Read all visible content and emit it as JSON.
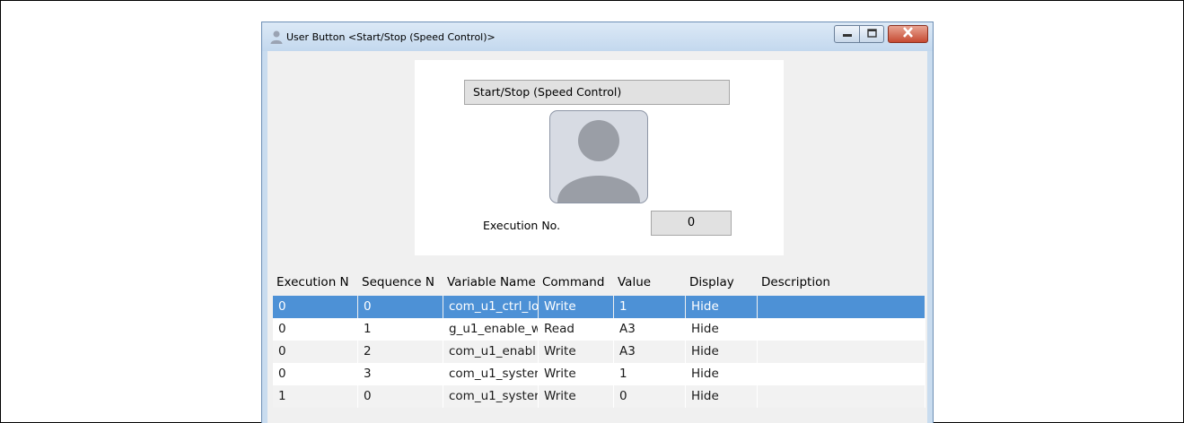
{
  "window": {
    "title": "User Button <Start/Stop (Speed Control)>",
    "icon": "user-icon",
    "controls": [
      "minimize-icon",
      "maximize-icon",
      "close-icon"
    ]
  },
  "preview": {
    "button_label": "Start/Stop (Speed Control)",
    "button_image": "person-avatar-icon",
    "execution_label": "Execution No.",
    "execution_value": "0"
  },
  "table": {
    "headers": [
      "Execution N",
      "Sequence N",
      "Variable Name",
      "Command",
      "Value",
      "Display",
      "Description"
    ],
    "rows": [
      {
        "execution": "0",
        "sequence": "0",
        "variable": "com_u1_ctrl_lo",
        "command": "Write",
        "value": "1",
        "display": "Hide",
        "description": "",
        "selected": true
      },
      {
        "execution": "0",
        "sequence": "1",
        "variable": "g_u1_enable_w",
        "command": "Read",
        "value": "A3",
        "display": "Hide",
        "description": ""
      },
      {
        "execution": "0",
        "sequence": "2",
        "variable": "com_u1_enabl",
        "command": "Write",
        "value": "A3",
        "display": "Hide",
        "description": ""
      },
      {
        "execution": "0",
        "sequence": "3",
        "variable": "com_u1_syster",
        "command": "Write",
        "value": "1",
        "display": "Hide",
        "description": ""
      },
      {
        "execution": "1",
        "sequence": "0",
        "variable": "com_u1_syster",
        "command": "Write",
        "value": "0",
        "display": "Hide",
        "description": ""
      }
    ]
  },
  "colors": {
    "selection": "#4d91d6",
    "title_gradient_top": "#dce9f6",
    "close_button": "#c64a32"
  }
}
